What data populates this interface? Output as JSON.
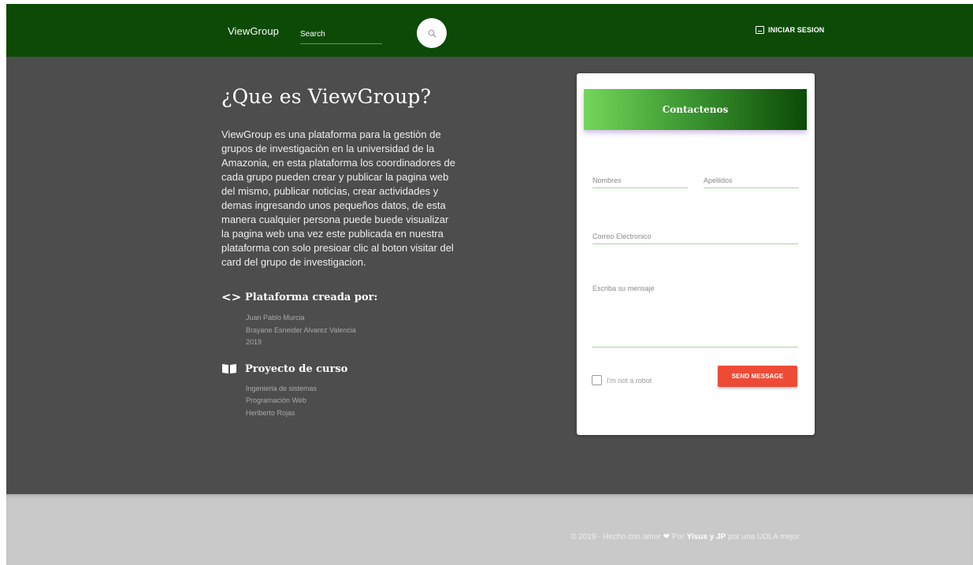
{
  "navbar": {
    "brand": "ViewGroup",
    "search": {
      "placeholder": "Search",
      "value": "",
      "icon": "search-icon"
    },
    "login_label": "INICIAR SESION",
    "background": "#0c4a06"
  },
  "about": {
    "title": "¿Que es ViewGroup?",
    "description": "ViewGroup es una plataforma para la gestiòn de grupos de investigaciòn en la universidad de la Amazonia, en esta plataforma los coordinadores de cada grupo pueden crear y publicar la pagina web del mismo, publicar noticias, crear actividades y demas ingresando unos pequeños datos, de esta manera cualquier persona puede buede visualizar la pagina web una vez este publicada en nuestra plataforma con solo presioar clic al boton visitar del card del grupo de investigacion.",
    "creators": {
      "heading": "Plataforma creada por:",
      "icon": "code-icon",
      "items": [
        "Juan Pablo Murcia",
        "Brayane Esneider Alvarez Valencia",
        "2019"
      ]
    },
    "course": {
      "heading": "Proyecto de curso",
      "icon": "book-icon",
      "items": [
        "Ingenieria de sistemas",
        "Programación Web",
        "Heriberto Rojas"
      ]
    }
  },
  "contact": {
    "title": "Contactenos",
    "fields": {
      "nombres": {
        "placeholder": "Nombres"
      },
      "apellidos": {
        "placeholder": "Apellidos"
      },
      "correo": {
        "placeholder": "Correo Electronico"
      },
      "mensaje": {
        "placeholder": "Escriba su mensaje"
      }
    },
    "robot_label": "I'm not a robot",
    "send_label": "SEND MESSAGE",
    "accent_color": "#ee4b36"
  },
  "footer": {
    "prefix": "© 2019 · Hecho con amor",
    "by": "Por",
    "authors": "Yisus y JP",
    "suffix": "por una UDLA mejor"
  }
}
